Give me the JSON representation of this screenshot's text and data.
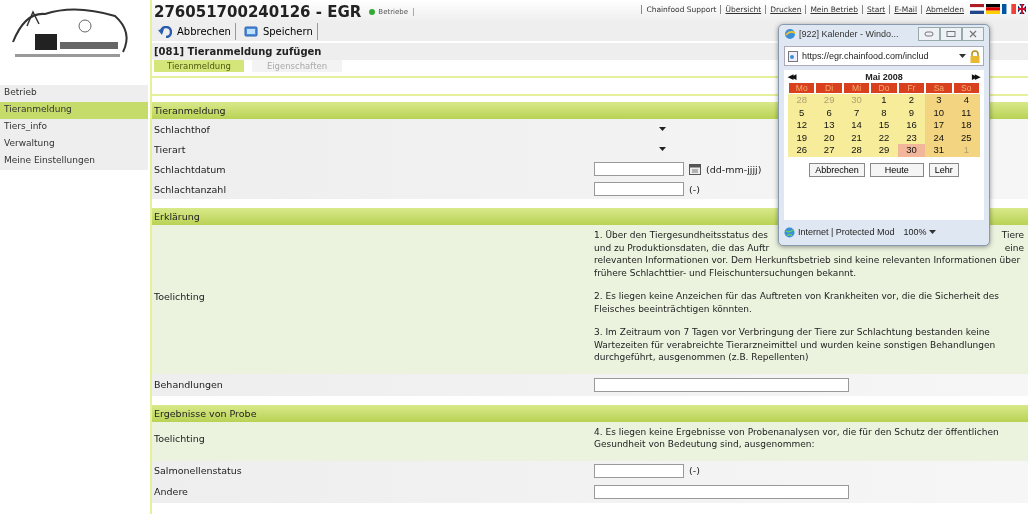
{
  "header": {
    "title": "276051700240126 - EGR",
    "badge": "Betriebe",
    "links": [
      "Chainfood Support",
      "Übersicht",
      "Drucken",
      "Mein Betrieb",
      "Start",
      "E-Mail",
      "Abmelden"
    ]
  },
  "toolbar": {
    "buttons": [
      {
        "kind": "undo",
        "label": "Abbrechen"
      },
      {
        "kind": "save",
        "label": "Speichern"
      }
    ]
  },
  "page_title": "[081] Tieranmeldung zufügen",
  "tabs": [
    {
      "label": "Tieranmeldung",
      "selected": true
    },
    {
      "label": "Eigenschaften",
      "selected": false
    }
  ],
  "sidebar": {
    "items": [
      {
        "label": "Betrieb",
        "selected": false
      },
      {
        "label": "Tieranmeldung",
        "selected": true
      },
      {
        "label": "Tiers_info",
        "selected": false
      },
      {
        "label": "Verwaltung",
        "selected": false
      },
      {
        "label": "Meine Einstellungen",
        "selected": false
      }
    ]
  },
  "sections": [
    {
      "title": "Tieranmeldung",
      "rows": [
        {
          "kind": "select",
          "label": "Schlachthof"
        },
        {
          "kind": "select",
          "label": "Tierart"
        },
        {
          "kind": "date",
          "label": "Schlachtdatum",
          "hint": "(dd-mm-jjjj)"
        },
        {
          "kind": "input",
          "label": "Schlachtanzahl",
          "hint": "(-)"
        }
      ]
    },
    {
      "title": "Erklärung",
      "rows": [
        {
          "kind": "text",
          "label": "Toelichting",
          "lines": [
            [
              "1. Über den Tiergesundheitsstatus des",
              "Tiere"
            ],
            [
              "und zu Produktionsdaten, die das Auftr",
              "eine"
            ],
            [
              "relevanten Informationen vor. Dem Herkunftsbetrieb sind keine relevanten Informationen über"
            ],
            [
              "frühere Schlachttier- und Fleischuntersuchungen bekannt."
            ]
          ],
          "paragraphs": [
            "2. Es liegen keine Anzeichen für das Auftreten von Krankheiten vor, die die Sicherheit des Fleisches beeinträchtigen könnten.",
            "3. Im Zeitraum von 7 Tagen vor Verbringung der Tiere zur Schlachtung bestanden keine Wartezeiten für verabreichte Tierarzneimittel und wurden keine sonstigen Behandlungen durchgeführt, ausgenommen (z.B. Repellenten)"
          ]
        },
        {
          "kind": "wide",
          "label": "Behandlungen"
        }
      ]
    },
    {
      "title": "Ergebnisse von Probe",
      "rows": [
        {
          "kind": "text",
          "label": "Toelichting",
          "paragraphs": [
            "4. Es liegen keine Ergebnisse von Probenanalysen vor, die für den Schutz der öffentlichen Gesundheit von Bedeutung sind, ausgenommen:"
          ]
        },
        {
          "kind": "input",
          "label": "Salmonellenstatus",
          "hint": "(-)"
        },
        {
          "kind": "wide",
          "label": "Andere"
        }
      ]
    }
  ],
  "popup": {
    "title": "[922] Kalender - Windo...",
    "url": "https://egr.chainfood.com/includ",
    "status": "Internet | Protected Mod",
    "zoom": "100%",
    "calendar": {
      "prev": "◀◀",
      "next": "▶▶",
      "month": "Mai 2008",
      "weekdays": [
        "Mo",
        "Di",
        "Mi",
        "Do",
        "Fr",
        "Sa",
        "So"
      ],
      "days": [
        {
          "day": "28",
          "outside": true,
          "today": false
        },
        {
          "day": "29",
          "outside": true,
          "today": false
        },
        {
          "day": "30",
          "outside": true,
          "today": false
        },
        {
          "day": "1",
          "outside": false,
          "today": false
        },
        {
          "day": "2",
          "outside": false,
          "today": false
        },
        {
          "day": "3",
          "outside": false,
          "today": false
        },
        {
          "day": "4",
          "outside": false,
          "today": false
        },
        {
          "day": "5",
          "outside": false,
          "today": false
        },
        {
          "day": "6",
          "outside": false,
          "today": false
        },
        {
          "day": "7",
          "outside": false,
          "today": false
        },
        {
          "day": "8",
          "outside": false,
          "today": false
        },
        {
          "day": "9",
          "outside": false,
          "today": false
        },
        {
          "day": "10",
          "outside": false,
          "today": false
        },
        {
          "day": "11",
          "outside": false,
          "today": false
        },
        {
          "day": "12",
          "outside": false,
          "today": false
        },
        {
          "day": "13",
          "outside": false,
          "today": false
        },
        {
          "day": "14",
          "outside": false,
          "today": false
        },
        {
          "day": "15",
          "outside": false,
          "today": false
        },
        {
          "day": "16",
          "outside": false,
          "today": false
        },
        {
          "day": "17",
          "outside": false,
          "today": false
        },
        {
          "day": "18",
          "outside": false,
          "today": false
        },
        {
          "day": "19",
          "outside": false,
          "today": false
        },
        {
          "day": "20",
          "outside": false,
          "today": false
        },
        {
          "day": "21",
          "outside": false,
          "today": false
        },
        {
          "day": "22",
          "outside": false,
          "today": false
        },
        {
          "day": "23",
          "outside": false,
          "today": false
        },
        {
          "day": "24",
          "outside": false,
          "today": false
        },
        {
          "day": "25",
          "outside": false,
          "today": false
        },
        {
          "day": "26",
          "outside": false,
          "today": false
        },
        {
          "day": "27",
          "outside": false,
          "today": false
        },
        {
          "day": "28",
          "outside": false,
          "today": false
        },
        {
          "day": "29",
          "outside": false,
          "today": false
        },
        {
          "day": "30",
          "outside": false,
          "today": true
        },
        {
          "day": "31",
          "outside": false,
          "today": false
        },
        {
          "day": "1",
          "outside": true,
          "today": false
        }
      ],
      "buttons": [
        "Abbrechen",
        "Heute",
        "Lehr"
      ]
    }
  }
}
